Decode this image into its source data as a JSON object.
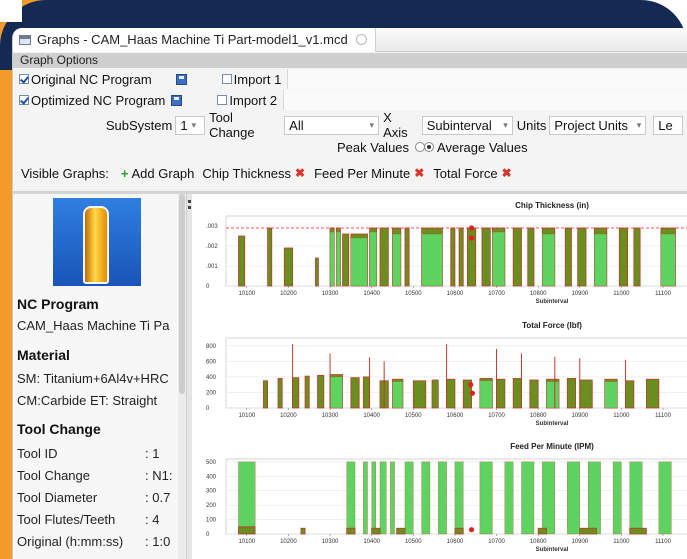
{
  "window": {
    "title": "Graphs - CAM_Haas Machine Ti Part-model1_v1.mcd"
  },
  "graph_options": {
    "header": "Graph Options",
    "original_program_label": "Original NC Program",
    "optimized_program_label": "Optimized NC Program",
    "import1_label": "Import 1",
    "import2_label": "Import 2",
    "subsystem_label": "SubSystem",
    "subsystem_value": "1",
    "tool_change_label": "Tool Change",
    "tool_change_value": "All",
    "x_axis_label": "X Axis",
    "x_axis_value": "Subinterval",
    "units_label": "Units",
    "units_value": "Project Units",
    "truncated_button": "Le",
    "peak_values_label": "Peak Values",
    "average_values_label": "Average Values",
    "visible_graphs_label": "Visible Graphs:",
    "add_graph_label": "Add Graph",
    "visible_graphs": [
      "Chip Thickness",
      "Feed Per Minute",
      "Total Force"
    ]
  },
  "left_panel": {
    "nc_program_heading": "NC Program",
    "nc_program_value": "CAM_Haas Machine Ti Pa",
    "material_heading": "Material",
    "sm_value": "SM: Titanium+6Al4v+HRC",
    "cm_value": "CM:Carbide ET: Straight",
    "tool_change_heading": "Tool Change",
    "rows": [
      {
        "key": "Tool ID",
        "value": ": 1"
      },
      {
        "key": "Tool Change",
        "value": ": N1:"
      },
      {
        "key": "Tool Diameter",
        "value": ": 0.7"
      },
      {
        "key": "Tool Flutes/Teeth",
        "value": ": 4"
      },
      {
        "key": "Original (h:mm:ss)",
        "value": ": 1:0"
      }
    ]
  },
  "colors": {
    "original_fill": "#6b8f1f",
    "optimized_fill": "#5fd35f",
    "original_line": "#c0392b",
    "peak_marker": "#e02020",
    "accent": "#1e4f9e"
  },
  "chart_data": [
    {
      "type": "area",
      "title": "Chip Thickness (in)",
      "xlabel": "Subinterval",
      "ylabel": "",
      "x_ticks": [
        "10100",
        "10200",
        "10300",
        "10400",
        "10500",
        "10600",
        "10700",
        "10800",
        "10900",
        "11000",
        "11100"
      ],
      "y_ticks": [
        "0",
        ".001",
        ".002",
        ".003"
      ],
      "xlim": [
        10050,
        11160
      ],
      "ylim": [
        0,
        0.0035
      ],
      "reference_line": 0.0029,
      "series": [
        {
          "values": [
            [
              10080,
              10095,
              0.0025
            ],
            [
              10150,
              10160,
              0.0029
            ],
            [
              10190,
              10210,
              0.0019
            ],
            [
              10265,
              10272,
              0.0014
            ],
            [
              10300,
              10310,
              0.0029
            ],
            [
              10315,
              10325,
              0.0029
            ],
            [
              10330,
              10345,
              0.0026
            ],
            [
              10350,
              10390,
              0.0026
            ],
            [
              10395,
              10412,
              0.0029
            ],
            [
              10420,
              10440,
              0.0029
            ],
            [
              10450,
              10470,
              0.0029
            ],
            [
              10480,
              10490,
              0.0029
            ],
            [
              10520,
              10570,
              0.0029
            ],
            [
              10590,
              10600,
              0.0029
            ],
            [
              10610,
              10620,
              0.0029
            ],
            [
              10630,
              10650,
              0.0029
            ],
            [
              10665,
              10685,
              0.0029
            ],
            [
              10690,
              10720,
              0.0029
            ],
            [
              10740,
              10760,
              0.0029
            ],
            [
              10775,
              10790,
              0.0029
            ],
            [
              10810,
              10840,
              0.0029
            ],
            [
              10865,
              10880,
              0.0029
            ],
            [
              10895,
              10915,
              0.0029
            ],
            [
              10935,
              10965,
              0.0029
            ],
            [
              10995,
              11015,
              0.0029
            ],
            [
              11030,
              11045,
              0.0029
            ],
            [
              11095,
              11130,
              0.0029
            ]
          ]
        },
        {
          "values": [
            [
              10300,
              10310,
              0.0027
            ],
            [
              10315,
              10325,
              0.0027
            ],
            [
              10350,
              10390,
              0.0024
            ],
            [
              10395,
              10412,
              0.0027
            ],
            [
              10450,
              10470,
              0.0026
            ],
            [
              10520,
              10570,
              0.0026
            ],
            [
              10690,
              10720,
              0.0027
            ],
            [
              10810,
              10840,
              0.0026
            ],
            [
              10935,
              10965,
              0.0026
            ],
            [
              11095,
              11130,
              0.0026
            ]
          ]
        }
      ],
      "peaks": [
        [
          10640,
          0.0029
        ],
        [
          10640,
          0.0024
        ]
      ]
    },
    {
      "type": "area",
      "title": "Total Force (lbf)",
      "xlabel": "Subinterval",
      "ylabel": "",
      "x_ticks": [
        "10100",
        "10200",
        "10300",
        "10400",
        "10500",
        "10600",
        "10700",
        "10800",
        "10900",
        "11000",
        "11100"
      ],
      "y_ticks": [
        "0",
        "200",
        "400",
        "600",
        "800"
      ],
      "xlim": [
        10050,
        11160
      ],
      "ylim": [
        0,
        900
      ],
      "series": [
        {
          "values": [
            [
              10140,
              10150,
              350
            ],
            [
              10175,
              10185,
              380
            ],
            [
              10210,
              10225,
              390
            ],
            [
              10240,
              10250,
              410
            ],
            [
              10270,
              10285,
              420
            ],
            [
              10300,
              10330,
              430
            ],
            [
              10350,
              10370,
              390
            ],
            [
              10380,
              10395,
              400
            ],
            [
              10420,
              10440,
              350
            ],
            [
              10450,
              10475,
              370
            ],
            [
              10500,
              10530,
              350
            ],
            [
              10545,
              10560,
              360
            ],
            [
              10580,
              10600,
              370
            ],
            [
              10620,
              10640,
              360
            ],
            [
              10660,
              10690,
              380
            ],
            [
              10700,
              10720,
              370
            ],
            [
              10740,
              10760,
              380
            ],
            [
              10780,
              10800,
              360
            ],
            [
              10820,
              10850,
              370
            ],
            [
              10870,
              10890,
              380
            ],
            [
              10900,
              10930,
              360
            ],
            [
              10960,
              10990,
              370
            ],
            [
              11010,
              11030,
              350
            ],
            [
              11060,
              11090,
              370
            ]
          ]
        },
        {
          "values": [
            [
              10300,
              10330,
              400
            ],
            [
              10450,
              10475,
              340
            ],
            [
              10660,
              10690,
              350
            ],
            [
              10820,
              10850,
              340
            ],
            [
              10960,
              10990,
              340
            ]
          ]
        }
      ],
      "spikes": [
        [
          10210,
          820
        ],
        [
          10300,
          700
        ],
        [
          10395,
          650
        ],
        [
          10430,
          600
        ],
        [
          10580,
          820
        ],
        [
          10700,
          760
        ],
        [
          10760,
          700
        ],
        [
          10840,
          660
        ],
        [
          10900,
          640
        ],
        [
          11010,
          620
        ]
      ],
      "peaks": [
        [
          10638,
          300
        ],
        [
          10642,
          190
        ]
      ]
    },
    {
      "type": "area",
      "title": "Feed Per Minute (IPM)",
      "xlabel": "Subinterval",
      "ylabel": "",
      "x_ticks": [
        "10100",
        "10200",
        "10300",
        "10400",
        "10500",
        "10600",
        "10700",
        "10800",
        "10900",
        "11000",
        "11100"
      ],
      "y_ticks": [
        "0",
        "100",
        "200",
        "300",
        "400",
        "500"
      ],
      "xlim": [
        10050,
        11160
      ],
      "ylim": [
        0,
        520
      ],
      "series": [
        {
          "values": [
            [
              10080,
              10120,
              50
            ],
            [
              10230,
              10240,
              40
            ],
            [
              10340,
              10360,
              40
            ],
            [
              10400,
              10420,
              40
            ],
            [
              10460,
              10480,
              40
            ],
            [
              10600,
              10620,
              40
            ],
            [
              10800,
              10820,
              40
            ],
            [
              10900,
              10940,
              40
            ],
            [
              11020,
              11060,
              40
            ]
          ]
        },
        {
          "values": [
            [
              10080,
              10120,
              500
            ],
            [
              10340,
              10360,
              500
            ],
            [
              10380,
              10390,
              500
            ],
            [
              10400,
              10410,
              500
            ],
            [
              10420,
              10435,
              500
            ],
            [
              10445,
              10455,
              500
            ],
            [
              10480,
              10500,
              500
            ],
            [
              10520,
              10540,
              500
            ],
            [
              10560,
              10580,
              500
            ],
            [
              10600,
              10620,
              500
            ],
            [
              10660,
              10690,
              500
            ],
            [
              10720,
              10740,
              500
            ],
            [
              10760,
              10790,
              500
            ],
            [
              10810,
              10840,
              500
            ],
            [
              10870,
              10900,
              500
            ],
            [
              10920,
              10950,
              500
            ],
            [
              10980,
              11000,
              500
            ],
            [
              11020,
              11050,
              500
            ],
            [
              11090,
              11120,
              500
            ]
          ]
        }
      ],
      "peaks": [
        [
          10640,
          30
        ]
      ]
    }
  ]
}
